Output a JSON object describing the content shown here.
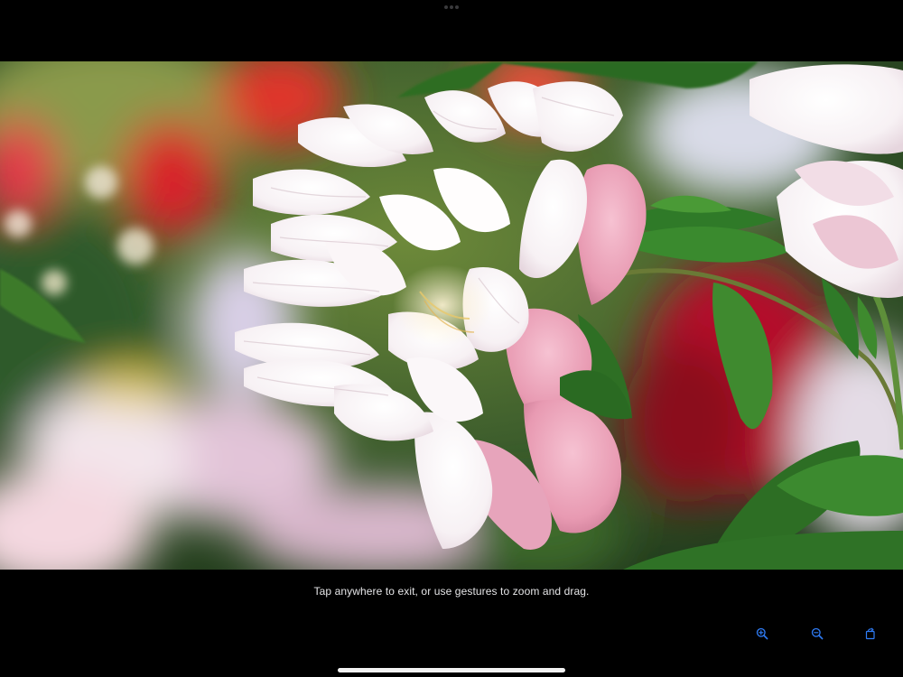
{
  "viewer": {
    "hint_text": "Tap anywhere to exit, or use gestures to zoom and drag."
  },
  "toolbar": {
    "accent_color": "#2f7cf6",
    "buttons": [
      {
        "icon": "zoom-in-icon"
      },
      {
        "icon": "zoom-out-icon"
      },
      {
        "icon": "rotate-icon"
      }
    ]
  },
  "photo": {
    "subject": "pink-white peony flower"
  }
}
